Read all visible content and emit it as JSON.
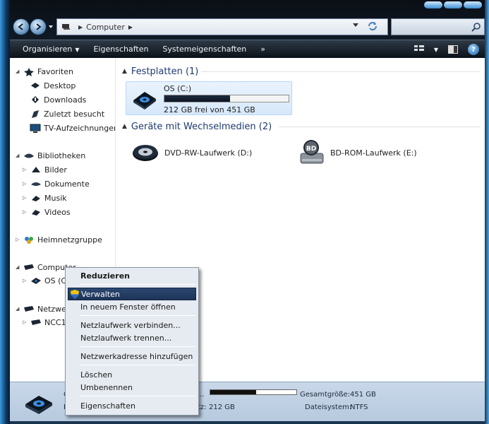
{
  "address_bar": {
    "path": [
      "Computer"
    ]
  },
  "command_bar": {
    "items": [
      "Organisieren",
      "Eigenschaften",
      "Systemeigenschaften",
      "»"
    ],
    "help_label": "?"
  },
  "nav": {
    "favorites_label": "Favoriten",
    "favorites": [
      "Desktop",
      "Downloads",
      "Zuletzt besucht",
      "TV-Aufzeichnungen"
    ],
    "libraries_label": "Bibliotheken",
    "libraries": [
      "Bilder",
      "Dokumente",
      "Musik",
      "Videos"
    ],
    "homegroup_label": "Heimnetzgruppe",
    "computer_label": "Computer",
    "computer_children": [
      "OS (C:"
    ],
    "network_label": "Netzwer",
    "network_children": [
      "NCC1"
    ]
  },
  "main": {
    "hard_disks_header": "Festplatten (1)",
    "drive_c": {
      "name": "OS (C:)",
      "used_fraction": 0.53,
      "free_text": "212 GB frei von 451 GB"
    },
    "removable_header": "Geräte mit Wechselmedien (2)",
    "removable": [
      "DVD-RW-Laufwerk (D:)",
      "BD-ROM-Laufwerk (E:)"
    ],
    "bd_label": "BD"
  },
  "details": {
    "name_frag_1": "C",
    "name_frag_2": "L",
    "used_label_frag": "...",
    "free_label_frag": "tz:",
    "free_value": "212 GB",
    "used_fraction": 0.53,
    "total_label": "Gesamtgröße:",
    "total_value": "451 GB",
    "fs_label": "Dateisystem:",
    "fs_value": "NTFS"
  },
  "context_menu": {
    "items": [
      "Reduzieren",
      "Verwalten",
      "In neuem Fenster öffnen",
      "Netzlaufwerk verbinden...",
      "Netzlaufwerk trennen...",
      "Netzwerkadresse hinzufügen",
      "Löschen",
      "Umbenennen",
      "Eigenschaften"
    ],
    "highlighted": "Verwalten"
  },
  "colors": {
    "accent": "#1d3458",
    "frame": "#1b3550",
    "details_bg": "#c9d8e9"
  }
}
